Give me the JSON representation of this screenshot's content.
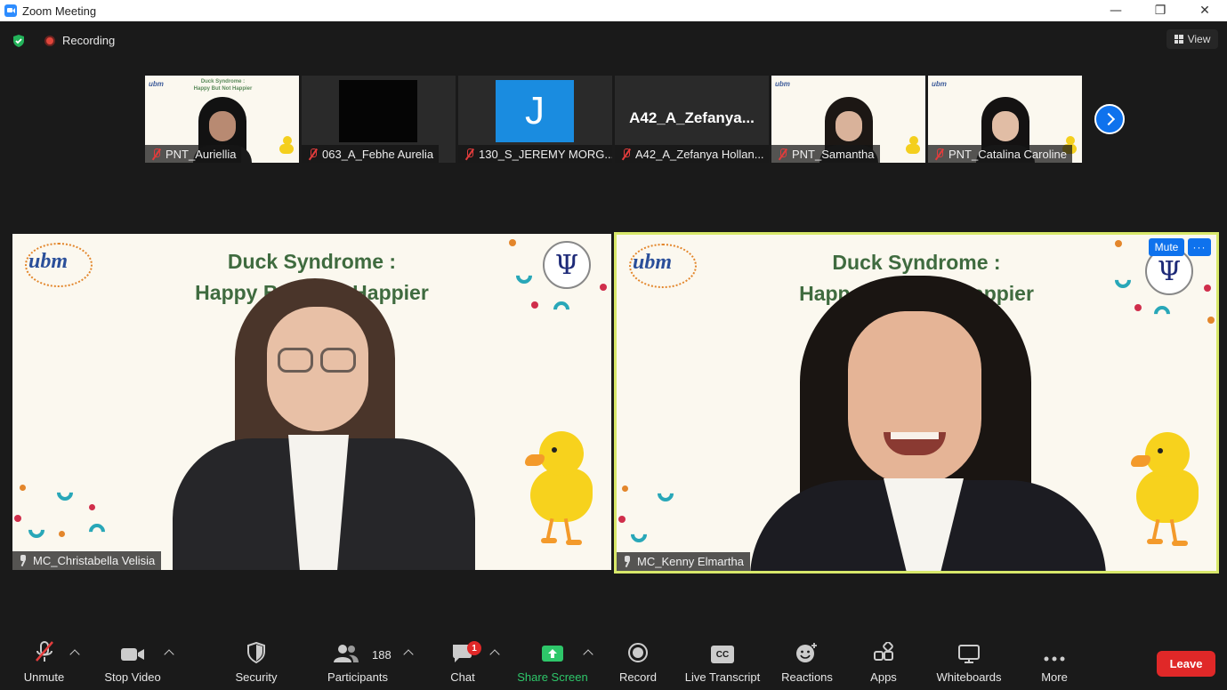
{
  "window": {
    "title": "Zoom Meeting"
  },
  "status": {
    "recording_label": "Recording",
    "view_label": "View"
  },
  "thumbnails": [
    {
      "name": "PNT_Auriellia",
      "type": "video"
    },
    {
      "name": "063_A_Febhe Aurelia",
      "type": "black"
    },
    {
      "name": "130_S_JEREMY MORG...",
      "type": "avatar",
      "initial": "J"
    },
    {
      "name": "A42_A_Zefanya Hollan...",
      "type": "name",
      "display": "A42_A_Zefanya..."
    },
    {
      "name": "PNT_Samantha",
      "type": "video"
    },
    {
      "name": "PNT_Catalina Caroline",
      "type": "video"
    }
  ],
  "slide": {
    "title_line1": "Duck Syndrome :",
    "title_line2_left": "Happy But",
    "title_line2_left_end": "Happier",
    "title_line2_right": "Happ",
    "title_line2_right_end": "Not Happier",
    "logo": "ubm",
    "psi": "Ψ",
    "thumb_title": "Duck Syndrome :\nHappy But Not Happier"
  },
  "main_tiles": {
    "left_name": "MC_Christabella Velisia",
    "right_name": "MC_Kenny Elmartha",
    "mute_label": "Mute",
    "more_label": "···"
  },
  "toolbar": {
    "unmute": "Unmute",
    "stop_video": "Stop Video",
    "security": "Security",
    "participants": "Participants",
    "participants_count": "188",
    "chat": "Chat",
    "chat_badge": "1",
    "share_screen": "Share Screen",
    "record": "Record",
    "live_transcript": "Live Transcript",
    "reactions": "Reactions",
    "apps": "Apps",
    "whiteboards": "Whiteboards",
    "more": "More",
    "leave": "Leave",
    "cc": "CC"
  },
  "colors": {
    "accent": "#0e72ed",
    "leave": "#e02828",
    "share": "#2ec76a",
    "active_border": "#d8e86a"
  }
}
